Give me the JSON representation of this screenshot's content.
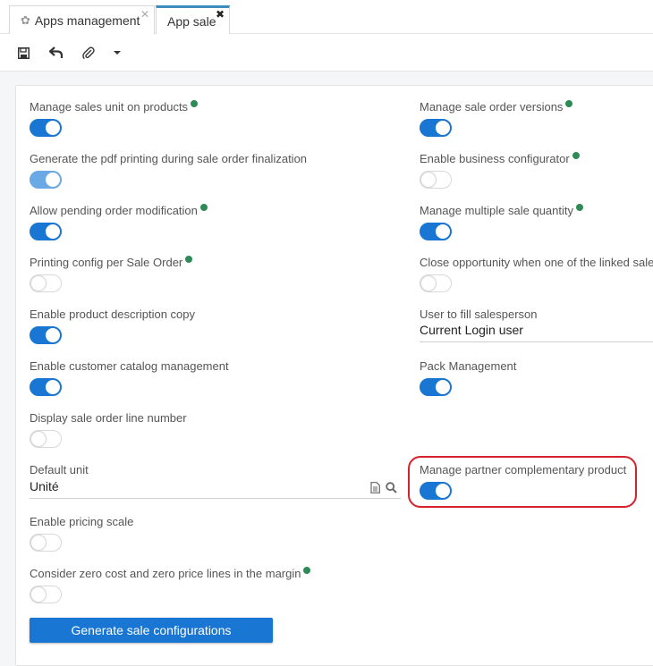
{
  "tabs": [
    {
      "label": "Apps management",
      "icon": "gear-icon"
    },
    {
      "label": "App sale",
      "icon": ""
    }
  ],
  "toolbar": {
    "buttons": [
      "save-icon",
      "undo-icon",
      "attachment-icon",
      "caret-down-icon"
    ]
  },
  "left": {
    "manage_sales_unit": {
      "label": "Manage sales unit on products",
      "on": true
    },
    "generate_pdf": {
      "label": "Generate the pdf printing during sale order finalization",
      "on": true
    },
    "allow_pending": {
      "label": "Allow pending order modification",
      "on": true
    },
    "printing_config": {
      "label": "Printing config per Sale Order",
      "on": false
    },
    "product_desc_copy": {
      "label": "Enable product description copy",
      "on": true
    },
    "customer_catalog": {
      "label": "Enable customer catalog management",
      "on": true
    },
    "display_line_number": {
      "label": "Display sale order line number",
      "on": false
    },
    "default_unit": {
      "label": "Default unit",
      "value": "Unité"
    },
    "pricing_scale": {
      "label": "Enable pricing scale",
      "on": false
    },
    "zero_cost": {
      "label": "Consider zero cost and zero price lines in the margin",
      "on": false
    }
  },
  "right": {
    "sale_order_versions": {
      "label": "Manage sale order versions",
      "on": true
    },
    "business_configurator": {
      "label": "Enable business configurator",
      "on": false
    },
    "multiple_sale_quantity": {
      "label": "Manage multiple sale quantity",
      "on": true
    },
    "close_opportunity": {
      "label": "Close opportunity when one of the linked sale o",
      "on": false
    },
    "user_fill_salesperson": {
      "label": "User to fill salesperson",
      "value": "Current Login user"
    },
    "pack_management": {
      "label": "Pack Management",
      "on": true
    },
    "partner_complementary": {
      "label": "Manage partner complementary product",
      "on": true
    }
  },
  "actions": {
    "generate_label": "Generate sale configurations"
  },
  "colors": {
    "accent": "#1976d2",
    "highlight": "#d6202a",
    "info": "#2e8b57"
  }
}
